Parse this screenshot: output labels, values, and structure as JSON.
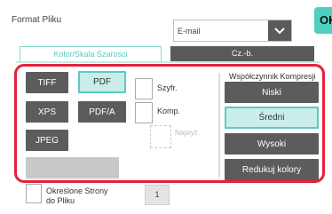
{
  "header": {
    "title": "Format Pliku",
    "ok_label": "OK",
    "file_type": {
      "value": "E-mail"
    }
  },
  "tabs": [
    {
      "label": "Kolor/Skala Szarości",
      "active": true
    },
    {
      "label": "Cz.-b.",
      "active": false
    }
  ],
  "formats": [
    {
      "label": "TIFF",
      "selected": false
    },
    {
      "label": "PDF",
      "selected": true
    },
    {
      "label": "XPS",
      "selected": false
    },
    {
      "label": "PDF/A",
      "selected": false
    },
    {
      "label": "JPEG",
      "selected": false
    }
  ],
  "options": {
    "encrypt_label": "Szyfr.",
    "compact_label": "Komp.",
    "ultra_label": "Najwyż."
  },
  "compression": {
    "title": "Współczynnik Kompresji",
    "buttons": [
      {
        "label": "Niski",
        "selected": false
      },
      {
        "label": "Średni",
        "selected": true
      },
      {
        "label": "Wysoki",
        "selected": false
      },
      {
        "label": "Redukuj kolory",
        "selected": false
      }
    ]
  },
  "pages": {
    "label_line1": "Określone Strony",
    "label_line2": "do Pliku",
    "count": "1"
  },
  "colors": {
    "accent": "#5ec8c0",
    "ok": "#4ed0c0",
    "highlight_border": "#e5203c",
    "button": "#5c5c5c"
  }
}
